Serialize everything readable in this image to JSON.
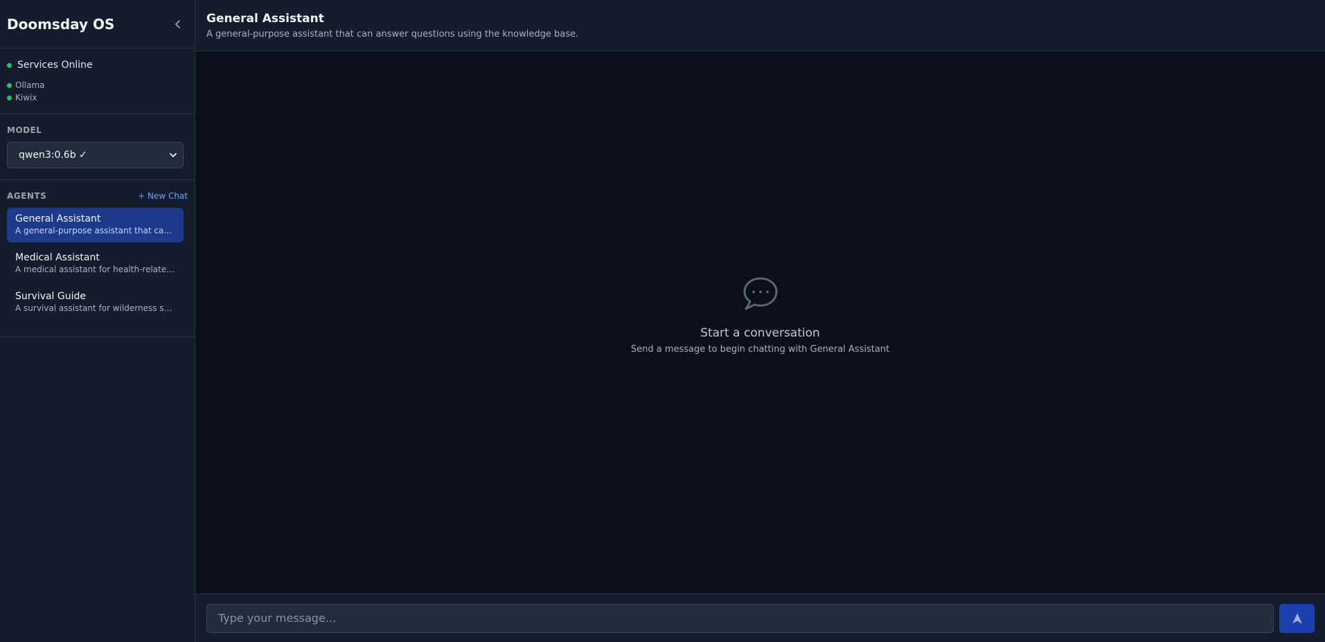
{
  "sidebar": {
    "app_title": "Doomsday OS",
    "services": {
      "status": "Services Online",
      "items": [
        {
          "name": "Ollama"
        },
        {
          "name": "Kiwix"
        }
      ]
    },
    "model": {
      "label": "MODEL",
      "selected": "qwen3:0.6b ✓"
    },
    "agents": {
      "label": "AGENTS",
      "new_chat": "+ New Chat",
      "items": [
        {
          "name": "General Assistant",
          "description": "A general-purpose assistant that can answer questions using the knowledge base."
        },
        {
          "name": "Medical Assistant",
          "description": "A medical assistant for health-related questions."
        },
        {
          "name": "Survival Guide",
          "description": "A survival assistant for wilderness skills."
        }
      ]
    }
  },
  "main": {
    "title": "General Assistant",
    "subtitle": "A general-purpose assistant that can answer questions using the knowledge base.",
    "empty_state": {
      "title": "Start a conversation",
      "subtitle": "Send a message to begin chatting with General Assistant"
    },
    "input": {
      "placeholder": "Type your message..."
    }
  },
  "colors": {
    "status_online": "#22c55e",
    "accent": "#1e40af",
    "link": "#60a5fa"
  },
  "icons": {
    "collapse": "chevron-left-icon",
    "select": "chevron-down-icon",
    "empty_state": "chat-bubble-icon",
    "send": "send-arrow-icon"
  }
}
